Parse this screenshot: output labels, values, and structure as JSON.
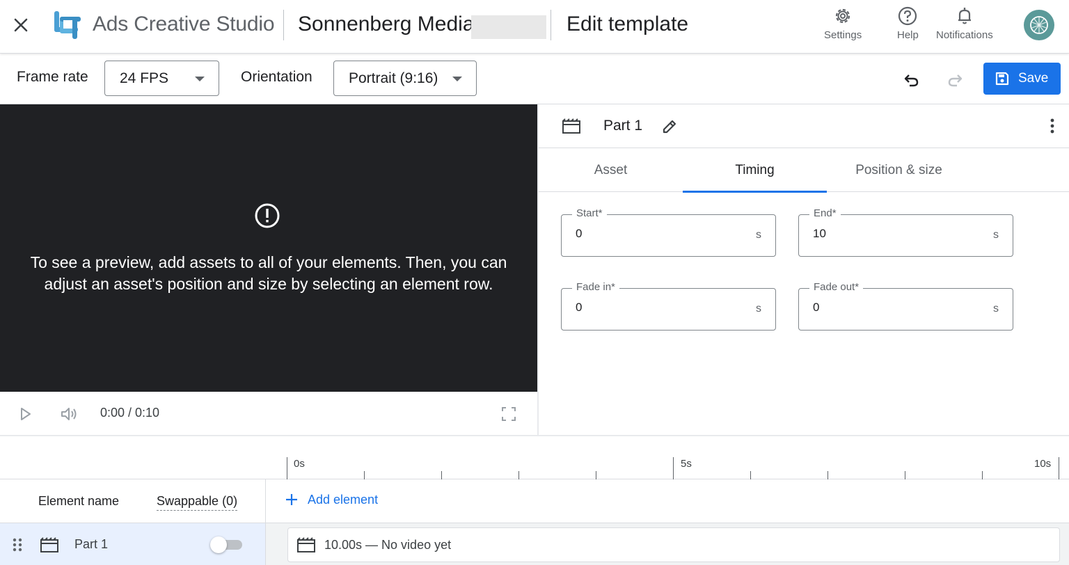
{
  "header": {
    "app_title": "Ads Creative Studio",
    "account_name": "Sonnenberg Media",
    "page_title": "Edit template",
    "actions": [
      {
        "label": "Settings",
        "icon": "gear-icon"
      },
      {
        "label": "Help",
        "icon": "help-circle-icon"
      },
      {
        "label": "Notifications",
        "icon": "bell-icon"
      }
    ]
  },
  "toolbar": {
    "frame_rate_label": "Frame rate",
    "frame_rate_value": "24 FPS",
    "orientation_label": "Orientation",
    "orientation_value": "Portrait (9:16)",
    "save_label": "Save"
  },
  "preview": {
    "message": "To see a preview, add assets to all of your elements. Then, you can adjust an asset's position and size by selecting an element row.",
    "time": "0:00 / 0:10"
  },
  "panel": {
    "part_name": "Part 1",
    "tabs": [
      {
        "label": "Asset",
        "active": false
      },
      {
        "label": "Timing",
        "active": true
      },
      {
        "label": "Position & size",
        "active": false
      }
    ],
    "fields": {
      "start": {
        "label": "Start*",
        "value": "0",
        "unit": "s"
      },
      "end": {
        "label": "End*",
        "value": "10",
        "unit": "s"
      },
      "fade_in": {
        "label": "Fade in*",
        "value": "0",
        "unit": "s"
      },
      "fade_out": {
        "label": "Fade out*",
        "value": "0",
        "unit": "s"
      }
    }
  },
  "timeline": {
    "ruler_labels": [
      "0s",
      "5s",
      "10s"
    ],
    "element_name_header": "Element name",
    "swappable_header": "Swappable (0)",
    "add_element_label": "Add element",
    "rows": [
      {
        "name": "Part 1",
        "swappable": false,
        "clip_text": "10.00s — No video yet"
      }
    ]
  },
  "colors": {
    "accent": "#1a73e8",
    "preview_bg": "#202124",
    "selected_row": "#e8f0fe"
  }
}
